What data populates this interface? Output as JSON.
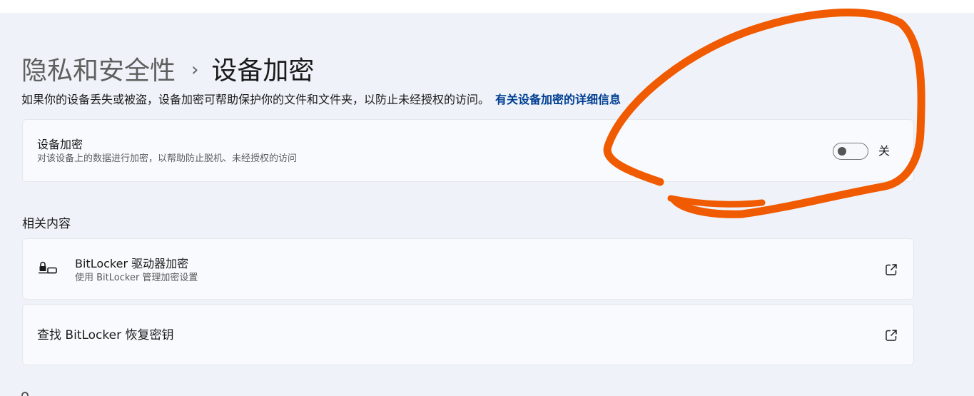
{
  "breadcrumb": {
    "parent": "隐私和安全性",
    "separator": "›",
    "current": "设备加密"
  },
  "description": {
    "text": "如果你的设备丢失或被盗，设备加密可帮助保护你的文件和文件夹，以防止未经授权的访问。",
    "link": "有关设备加密的详细信息"
  },
  "device_encryption": {
    "title": "设备加密",
    "subtitle": "对该设备上的数据进行加密，以帮助防止脱机、未经授权的访问",
    "toggle_state": "off",
    "toggle_label": "关"
  },
  "related": {
    "heading": "相关内容",
    "items": [
      {
        "icon": "lock-drive-icon",
        "title": "BitLocker 驱动器加密",
        "subtitle": "使用 BitLocker 管理加密设置",
        "action_icon": "open-external-icon"
      },
      {
        "title": "查找 BitLocker 恢复密钥",
        "action_icon": "open-external-icon"
      }
    ]
  },
  "colors": {
    "page_bg": "#eff3f9",
    "card_bg": "#f9fafd",
    "link": "#003e92",
    "annotation": "#f05a00"
  }
}
